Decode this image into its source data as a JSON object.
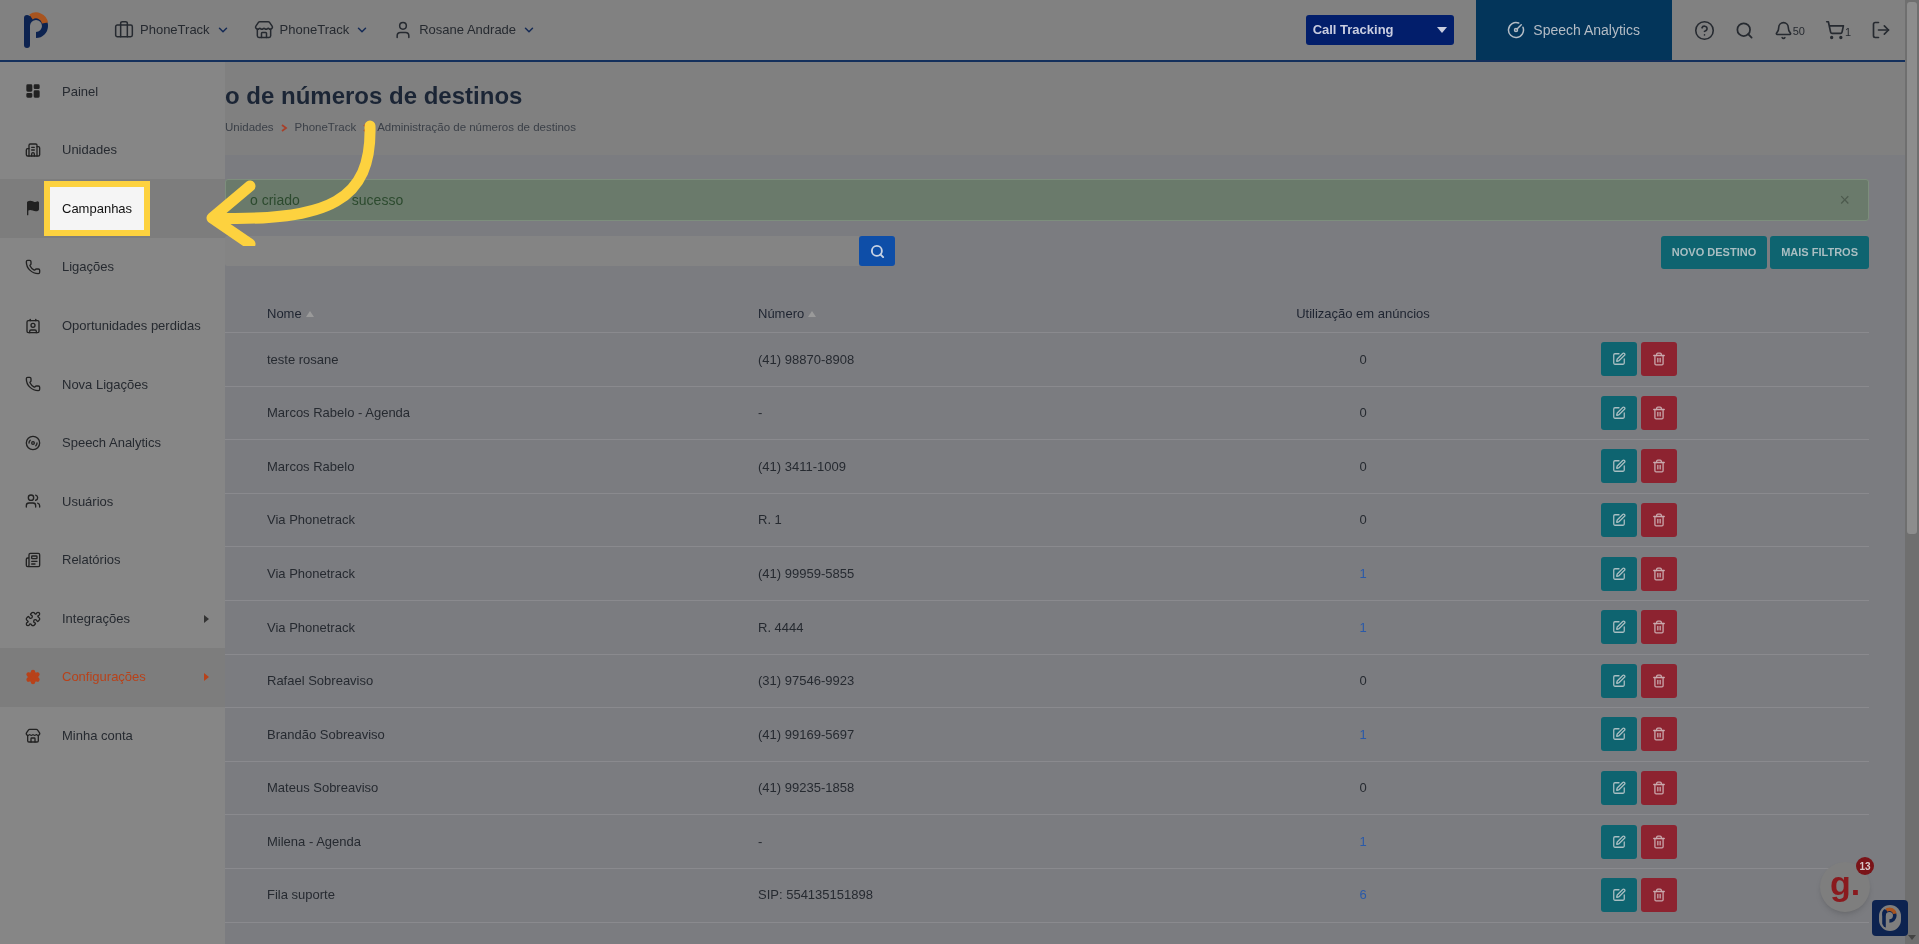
{
  "header": {
    "nav": [
      {
        "label": "PhoneTrack"
      },
      {
        "label": "PhoneTrack"
      },
      {
        "label": "Rosane Andrade"
      }
    ],
    "product_select": {
      "value": "Call Tracking"
    },
    "speech_analytics": {
      "label": "Speech Analytics"
    },
    "notifications": {
      "count": "50"
    },
    "cart": {
      "count": "1"
    }
  },
  "sidebar": {
    "items": [
      {
        "label": "Painel",
        "active": false,
        "highlighted": false,
        "submenu": false
      },
      {
        "label": "Unidades",
        "active": false,
        "highlighted": false,
        "submenu": false
      },
      {
        "label": "Campanhas",
        "active": false,
        "highlighted": true,
        "submenu": false
      },
      {
        "label": "Ligações",
        "active": false,
        "highlighted": false,
        "submenu": false
      },
      {
        "label": "Oportunidades perdidas",
        "active": false,
        "highlighted": false,
        "submenu": false
      },
      {
        "label": "Nova Ligações",
        "active": false,
        "highlighted": false,
        "submenu": false
      },
      {
        "label": "Speech Analytics",
        "active": false,
        "highlighted": false,
        "submenu": false
      },
      {
        "label": "Usuários",
        "active": false,
        "highlighted": false,
        "submenu": false
      },
      {
        "label": "Relatórios",
        "active": false,
        "highlighted": false,
        "submenu": false
      },
      {
        "label": "Integrações",
        "active": false,
        "highlighted": false,
        "submenu": true
      },
      {
        "label": "Configurações",
        "active": true,
        "highlighted": false,
        "submenu": true
      },
      {
        "label": "Minha conta",
        "active": false,
        "highlighted": false,
        "submenu": false
      }
    ]
  },
  "page": {
    "title": "o de números de destinos",
    "breadcrumb": [
      "Unidades",
      "PhoneTrack",
      "Administração de números de destinos"
    ]
  },
  "alert": {
    "text_parts": [
      "o criado",
      "sucesso"
    ],
    "close": "×"
  },
  "actions": [
    "NOVO DESTINO",
    "MAIS FILTROS"
  ],
  "table": {
    "columns": [
      {
        "label": "Nome",
        "sortable": true
      },
      {
        "label": "Número",
        "sortable": true
      },
      {
        "label": "Utilização em anúncios",
        "sortable": false
      }
    ],
    "rows": [
      {
        "name": "teste rosane",
        "number": "(41) 98870-8908",
        "usage": "0",
        "linked": false
      },
      {
        "name": "Marcos Rabelo - Agenda",
        "number": "-",
        "usage": "0",
        "linked": false
      },
      {
        "name": "Marcos Rabelo",
        "number": "(41) 3411-1009",
        "usage": "0",
        "linked": false
      },
      {
        "name": "Via Phonetrack",
        "number": "R. 1",
        "usage": "0",
        "linked": false
      },
      {
        "name": "Via Phonetrack",
        "number": "(41) 99959-5855",
        "usage": "1",
        "linked": true
      },
      {
        "name": "Via Phonetrack",
        "number": "R. 4444",
        "usage": "1",
        "linked": true
      },
      {
        "name": "Rafael Sobreaviso",
        "number": "(31) 97546-9923",
        "usage": "0",
        "linked": false
      },
      {
        "name": "Brandão Sobreaviso",
        "number": "(41) 99169-5697",
        "usage": "1",
        "linked": true
      },
      {
        "name": "Mateus Sobreaviso",
        "number": "(41) 99235-1858",
        "usage": "0",
        "linked": false
      },
      {
        "name": "Milena - Agenda",
        "number": "-",
        "usage": "1",
        "linked": true
      },
      {
        "name": "Fila suporte",
        "number": "SIP: 554135151898",
        "usage": "6",
        "linked": true
      }
    ]
  },
  "chat_widget": {
    "letter": "g.",
    "badge": "13"
  }
}
